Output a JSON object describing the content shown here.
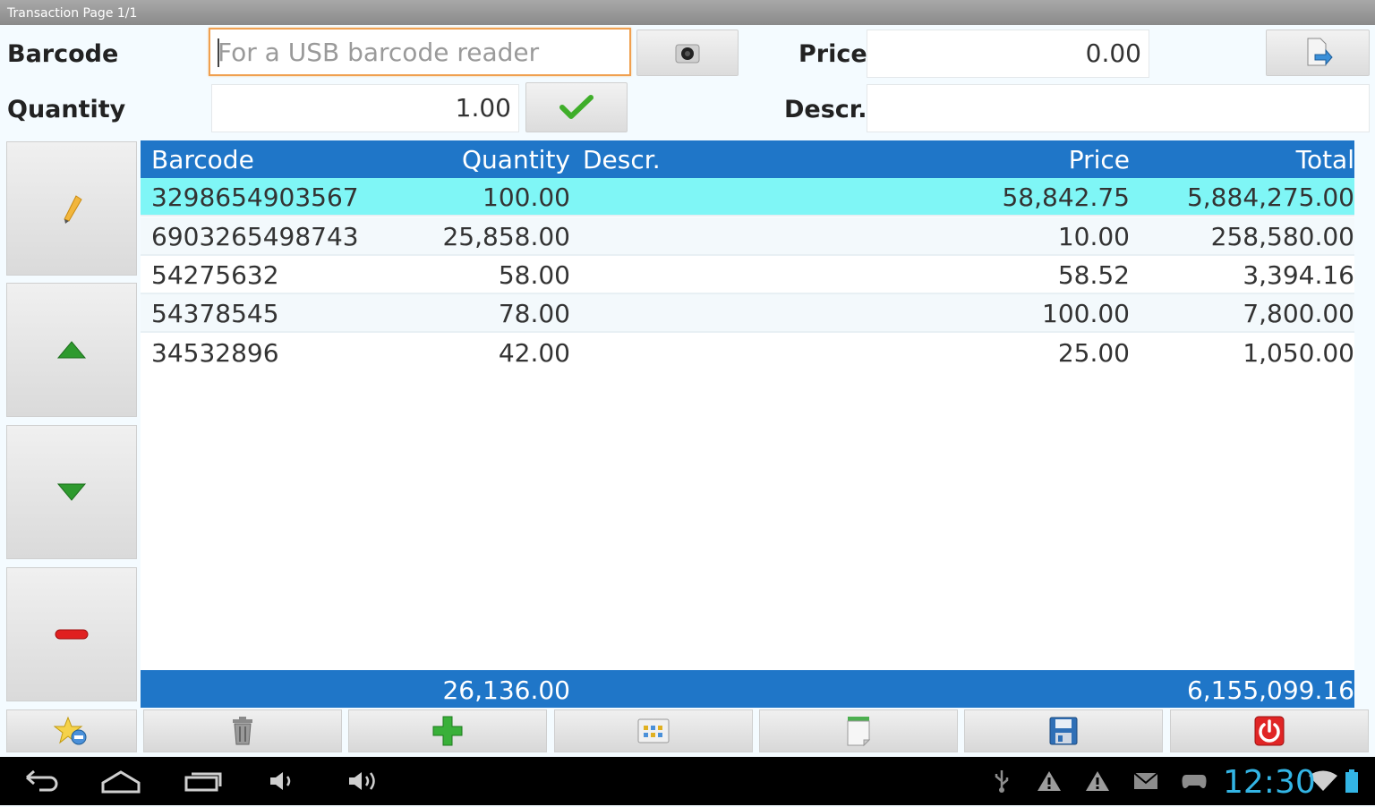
{
  "window": {
    "title": "Transaction Page 1/1"
  },
  "form": {
    "barcode_label": "Barcode",
    "barcode_placeholder": "For a USB barcode reader",
    "barcode_value": "",
    "price_label": "Price",
    "price_value": "0.00",
    "quantity_label": "Quantity",
    "quantity_value": "1.00",
    "descr_label": "Descr.",
    "descr_value": ""
  },
  "table": {
    "headers": {
      "barcode": "Barcode",
      "quantity": "Quantity",
      "descr": "Descr.",
      "price": "Price",
      "total": "Total"
    },
    "rows": [
      {
        "barcode": "3298654903567",
        "quantity": "100.00",
        "descr": "",
        "price": "58,842.75",
        "total": "5,884,275.00",
        "selected": true
      },
      {
        "barcode": "6903265498743",
        "quantity": "25,858.00",
        "descr": "",
        "price": "10.00",
        "total": "258,580.00"
      },
      {
        "barcode": "54275632",
        "quantity": "58.00",
        "descr": "",
        "price": "58.52",
        "total": "3,394.16"
      },
      {
        "barcode": "54378545",
        "quantity": "78.00",
        "descr": "",
        "price": "100.00",
        "total": "7,800.00"
      },
      {
        "barcode": "34532896",
        "quantity": "42.00",
        "descr": "",
        "price": "25.00",
        "total": "1,050.00"
      }
    ],
    "footer": {
      "quantity_total": "26,136.00",
      "grand_total": "6,155,099.16"
    }
  },
  "side_buttons": [
    "edit-pencil-icon",
    "arrow-up-icon",
    "arrow-down-icon",
    "remove-minus-icon"
  ],
  "bottom_buttons": [
    "favorites-star-icon",
    "trash-icon",
    "add-plus-icon",
    "calculator-icon",
    "notes-icon",
    "save-disk-icon",
    "power-off-icon"
  ],
  "status_bar": {
    "clock": "12:30"
  },
  "colors": {
    "header_blue": "#1f76c8",
    "selected_row": "#7ff6f6",
    "focus_orange": "#f0a050",
    "clock_blue": "#33b5e5"
  }
}
